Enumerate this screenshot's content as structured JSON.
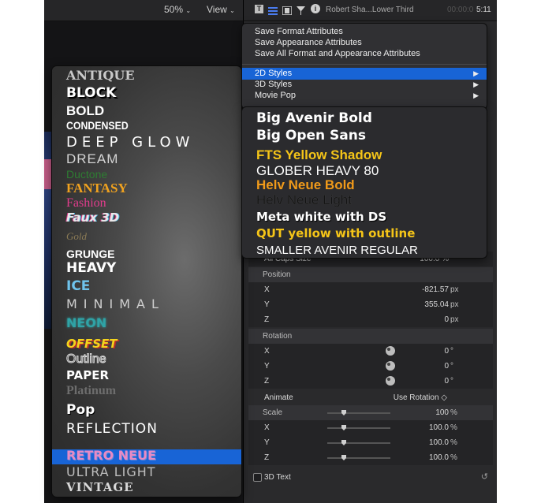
{
  "viewer_toolbar": {
    "zoom": "50%",
    "view": "View"
  },
  "inspector_toolbar": {
    "clip_title": "Robert Sha...Lower Third",
    "timecode_dim": "00:00:0",
    "timecode": "5:11"
  },
  "main_menu": {
    "items": [
      "Save Format Attributes",
      "Save Appearance Attributes",
      "Save All Format and Appearance Attributes"
    ],
    "submenus": [
      "2D Styles",
      "3D Styles",
      "Movie Pop"
    ]
  },
  "preset_submenu": {
    "items": [
      {
        "label": "Big Avenir Bold",
        "color": "#ffffff"
      },
      {
        "label": "Big Open Sans",
        "color": "#ffffff"
      },
      {
        "label": "FTS Yellow Shadow",
        "color": "#f5c518"
      },
      {
        "label": "GLOBER HEAVY 80",
        "color": "#ffffff"
      },
      {
        "label": "Helv Neue Bold",
        "color": "#f09a1a"
      },
      {
        "label": "Helv Neue Light",
        "color": "#111111"
      },
      {
        "label": "Meta white with DS",
        "color": "#ffffff"
      },
      {
        "label": "QUT yellow with outline",
        "color": "#f5c518"
      },
      {
        "label": "SMALLER AVENIR REGULAR",
        "color": "#ffffff"
      }
    ]
  },
  "styles_list": [
    {
      "label": "ANTIQUE",
      "color": "#c9c9c9"
    },
    {
      "label": "BLOCK",
      "color": "#ffffff"
    },
    {
      "label": "BOLD",
      "color": "#ffffff"
    },
    {
      "label": "CONDENSED",
      "color": "#ffffff"
    },
    {
      "label": "DEEP GLOW",
      "color": "#ffffff"
    },
    {
      "label": "DREAM",
      "color": "#d4d4d4"
    },
    {
      "label": "Ductone",
      "color": "#2e7d32"
    },
    {
      "label": "FANTASY",
      "color": "#f0a21f"
    },
    {
      "label": "Fashion",
      "color": "#e23c8c"
    },
    {
      "label": "Faux 3D",
      "color": "#e9e9e9"
    },
    {
      "label": "Gold",
      "color": "#8a7a55"
    },
    {
      "label": "GRUNGE",
      "color": "#ffffff"
    },
    {
      "label": "HEAVY",
      "color": "#ffffff"
    },
    {
      "label": "ICE",
      "color": "#6fc3ec"
    },
    {
      "label": "MINIMAL",
      "color": "#cfcfcf"
    },
    {
      "label": "NEON",
      "color": "#2fa3a6"
    },
    {
      "label": "OFFSET",
      "color": "#f4d41c"
    },
    {
      "label": "Outline",
      "color": "#d8d8d8"
    },
    {
      "label": "PAPER",
      "color": "#ffffff"
    },
    {
      "label": "Platinum",
      "color": "#6d6d6d"
    },
    {
      "label": "Pop",
      "color": "#ffffff"
    },
    {
      "label": "REFLECTION",
      "color": "#ffffff"
    },
    {
      "label": "RETRO NEUE",
      "color": "#e88ac4"
    },
    {
      "label": "ULTRA LIGHT",
      "color": "#bdbdbd"
    },
    {
      "label": "VINTAGE",
      "color": "#d9d9d9"
    }
  ],
  "selected_style": "RETRO NEUE",
  "inspector": {
    "partial_row": {
      "label": "All Caps Size",
      "value": "100.0 %"
    },
    "position": {
      "title": "Position",
      "rows": [
        {
          "axis": "X",
          "value": "-821.57",
          "unit": "px"
        },
        {
          "axis": "Y",
          "value": "355.04",
          "unit": "px"
        },
        {
          "axis": "Z",
          "value": "0",
          "unit": "px"
        }
      ]
    },
    "rotation": {
      "title": "Rotation",
      "rows": [
        {
          "axis": "X",
          "value": "0",
          "unit": "°"
        },
        {
          "axis": "Y",
          "value": "0",
          "unit": "°"
        },
        {
          "axis": "Z",
          "value": "0",
          "unit": "°"
        }
      ]
    },
    "animate": {
      "label": "Animate",
      "value": "Use Rotation ◇"
    },
    "scale": {
      "title": "Scale",
      "value": "100",
      "unit": "%",
      "rows": [
        {
          "axis": "X",
          "value": "100.0",
          "unit": "%"
        },
        {
          "axis": "Y",
          "value": "100.0",
          "unit": "%"
        },
        {
          "axis": "Z",
          "value": "100.0",
          "unit": "%"
        }
      ]
    },
    "text3d": {
      "label": "3D Text"
    }
  },
  "colors": {
    "accent": "#1864d6"
  }
}
